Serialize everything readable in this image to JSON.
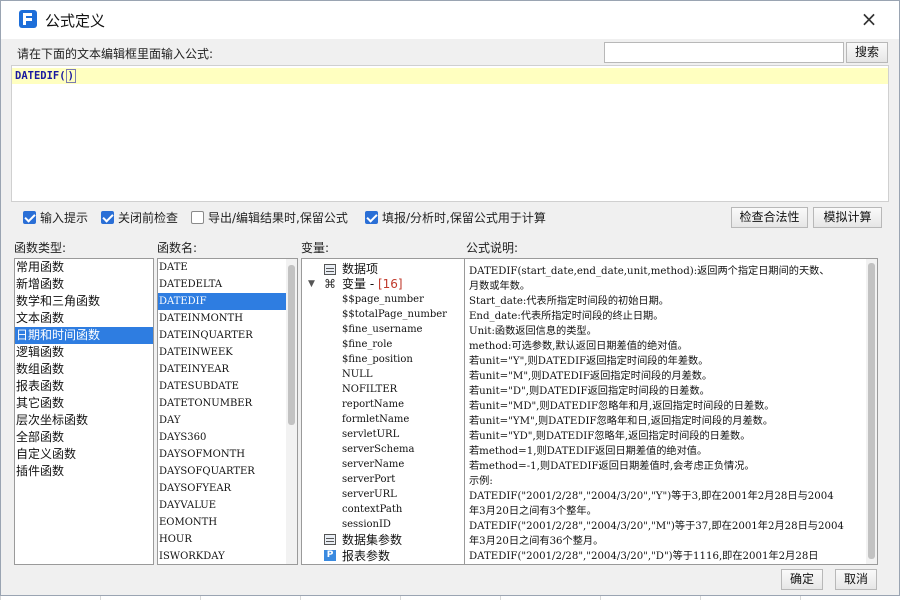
{
  "dialog": {
    "title": "公式定义",
    "close_icon": "×"
  },
  "editor": {
    "prompt": "请在下面的文本编辑框里面输入公式:",
    "search_placeholder": "",
    "search_button": "搜索",
    "formula_name": "DATEDIF",
    "formula_open": "(",
    "formula_close": ")"
  },
  "options": {
    "input_hint": {
      "label": "输入提示",
      "checked": true
    },
    "close_check": {
      "label": "关闭前检查",
      "checked": true
    },
    "export_keep": {
      "label": "导出/编辑结果时,保留公式",
      "checked": false
    },
    "fill_keep": {
      "label": "填报/分析时,保留公式用于计算",
      "checked": true
    },
    "check_validity_button": "检查合法性",
    "simulate_button": "模拟计算"
  },
  "columns": {
    "category_label": "函数类型:",
    "function_label": "函数名:",
    "variable_label": "变量:",
    "description_label": "公式说明:"
  },
  "categories": [
    "常用函数",
    "新增函数",
    "数学和三角函数",
    "文本函数",
    "日期和时间函数",
    "逻辑函数",
    "数组函数",
    "报表函数",
    "其它函数",
    "层次坐标函数",
    "全部函数",
    "自定义函数",
    "插件函数"
  ],
  "selected_category_index": 4,
  "functions": [
    "DATE",
    "DATEDELTA",
    "DATEDIF",
    "DATEINMONTH",
    "DATEINQUARTER",
    "DATEINWEEK",
    "DATEINYEAR",
    "DATESUBDATE",
    "DATETONUMBER",
    "DAY",
    "DAYS360",
    "DAYSOFMONTH",
    "DAYSOFQUARTER",
    "DAYSOFYEAR",
    "DAYVALUE",
    "EOMONTH",
    "HOUR",
    "ISWORKDAY"
  ],
  "selected_function_index": 2,
  "variables": {
    "dataset_node": "数据项",
    "var_node_label": "变量 - ",
    "var_node_count": "[16]",
    "leaves": [
      "$$page_number",
      "$$totalPage_number",
      "$fine_username",
      "$fine_role",
      "$fine_position",
      "NULL",
      "NOFILTER",
      "reportName",
      "formletName",
      "servletURL",
      "serverSchema",
      "serverName",
      "serverPort",
      "serverURL",
      "contextPath",
      "sessionID"
    ],
    "dataset_params": "数据集参数",
    "report_params": "报表参数",
    "report_params_badge": "P"
  },
  "description": [
    "DATEDIF(start_date,end_date,unit,method):返回两个指定日期间的天数、",
    "月数或年数。",
    "Start_date:代表所指定时间段的初始日期。",
    "End_date:代表所指定时间段的终止日期。",
    "Unit:函数返回信息的类型。",
    "method:可选参数,默认返回日期差值的绝对值。",
    "若unit=\"Y\",则DATEDIF返回指定时间段的年差数。",
    "若unit=\"M\",则DATEDIF返回指定时间段的月差数。",
    "若unit=\"D\",则DATEDIF返回指定时间段的日差数。",
    "若unit=\"MD\",则DATEDIF忽略年和月,返回指定时间段的日差数。",
    "若unit=\"YM\",则DATEDIF忽略年和日,返回指定时间段的月差数。",
    "若unit=\"YD\",则DATEDIF忽略年,返回指定时间段的日差数。",
    "若method=1,则DATEDIF返回日期差值的绝对值。",
    "若method=-1,则DATEDIF返回日期差值时,会考虑正负情况。",
    "示例:",
    "DATEDIF(\"2001/2/28\",\"2004/3/20\",\"Y\")等于3,即在2001年2月28日与2004",
    "年3月20日之间有3个整年。",
    "DATEDIF(\"2001/2/28\",\"2004/3/20\",\"M\")等于37,即在2001年2月28日与2004",
    "年3月20日之间有36个整月。",
    "DATEDIF(\"2001/2/28\",\"2004/3/20\",\"D\")等于1116,即在2001年2月28日"
  ],
  "footer": {
    "ok": "确定",
    "cancel": "取消"
  },
  "colors": {
    "selection": "#2e7de1",
    "editor_highlight": "#ffffc0",
    "accent": "#1d6ed9"
  }
}
